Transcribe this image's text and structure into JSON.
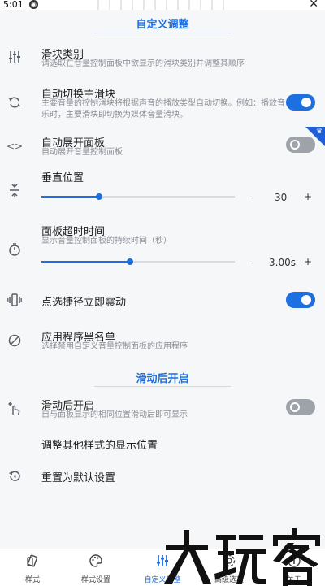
{
  "statusbar": {
    "time": "5:01"
  },
  "sections": {
    "custom": "自定义调整",
    "after_open": "滑动后开启"
  },
  "rows": {
    "slider_type": {
      "title": "滑块类别",
      "sub": "请选取在音量控制面板中欲显示的滑块类别并调整其顺序",
      "icon": "sliders-icon"
    },
    "auto_switch": {
      "title": "自动切换主滑块",
      "sub": "主要音量的控制滑块将根据声音的播放类型自动切换。例如：播放音乐时，主要滑块即切换为媒体音量滑块。",
      "icon": "refresh-icon",
      "toggle": true
    },
    "auto_expand": {
      "title": "自动展开面板",
      "sub": "自动展开音量控制面板",
      "icon": "code-icon",
      "toggle": false,
      "pro": true
    },
    "vertical_position": {
      "title": "垂直位置",
      "icon": "vertical-align-icon",
      "value": "30",
      "fraction": 0.3,
      "minus": "-",
      "plus": "+"
    },
    "panel_timeout": {
      "title": "面板超时时间",
      "sub": "显示音量控制面板的持续时间（秒）",
      "icon": "timer-icon",
      "value": "3.00s",
      "fraction": 0.46,
      "minus": "-",
      "plus": "+"
    },
    "vibrate": {
      "title": "点选捷径立即震动",
      "icon": "vibrate-icon",
      "toggle": true
    },
    "blacklist": {
      "title": "应用程序黑名单",
      "sub": "选择禁用自定义音量控制面板的应用程序",
      "icon": "block-icon"
    },
    "swipe_open": {
      "title": "滑动后开启",
      "sub": "自与面板显示的相同位置滑动后即可显示",
      "icon": "swipe-gesture-icon",
      "toggle": false
    },
    "adjust_other": {
      "title": "调整其他样式的显示位置"
    },
    "reset": {
      "title": "重置为默认设置",
      "icon": "restore-icon"
    }
  },
  "nav": [
    {
      "label": "样式",
      "icon": "style-icon",
      "active": false
    },
    {
      "label": "样式设置",
      "icon": "palette-icon",
      "active": false
    },
    {
      "label": "自定义调整",
      "icon": "tune-icon",
      "active": true
    },
    {
      "label": "高级选项",
      "icon": "gear-icon",
      "active": false
    },
    {
      "label": "关于",
      "icon": "info-icon",
      "active": false
    }
  ],
  "watermark": "大玩家",
  "colors": {
    "accent": "#1e6fe0",
    "toggle_off": "#9ea3a9",
    "background": "#f6f7f9"
  }
}
